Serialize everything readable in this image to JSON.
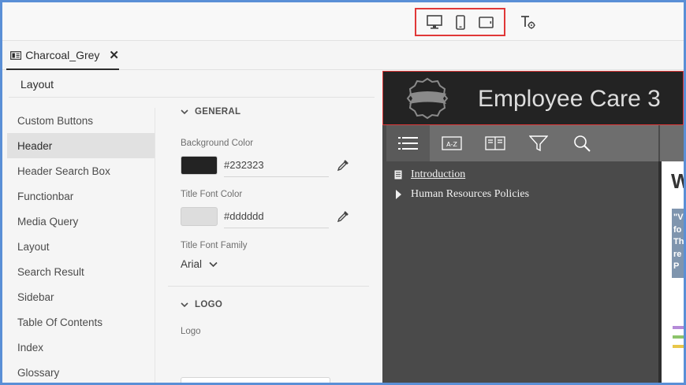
{
  "tab": {
    "title": "Charcoal_Grey"
  },
  "panel": {
    "title": "Layout"
  },
  "categories": [
    "Custom Buttons",
    "Header",
    "Header Search Box",
    "Functionbar",
    "Media Query",
    "Layout",
    "Search Result",
    "Sidebar",
    "Table Of Contents",
    "Index",
    "Glossary"
  ],
  "active_category": "Header",
  "general": {
    "heading": "GENERAL",
    "bg_label": "Background Color",
    "bg_value": "#232323",
    "title_color_label": "Title Font Color",
    "title_color_value": "#dddddd",
    "font_family_label": "Title Font Family",
    "font_family_value": "Arial"
  },
  "logo": {
    "heading": "LOGO",
    "label": "Logo"
  },
  "preview": {
    "title": "Employee Care 3",
    "toc": [
      {
        "label": "Introduction"
      },
      {
        "label": "Human Resources Policies"
      }
    ],
    "content_heading": "W",
    "quote_lines": [
      "\"V",
      "fo",
      "Th",
      "re",
      "P"
    ]
  },
  "colors": {
    "accent_red": "#e03838",
    "header_bg": "#232323",
    "title_color": "#dddddd"
  }
}
